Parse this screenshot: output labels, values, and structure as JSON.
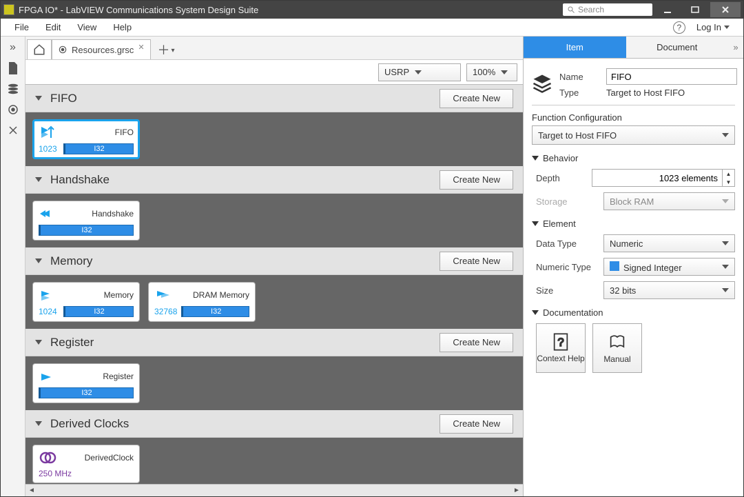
{
  "title": "FPGA IO* - LabVIEW Communications System Design Suite",
  "search_placeholder": "Search",
  "menu": {
    "file": "File",
    "edit": "Edit",
    "view": "View",
    "help": "Help",
    "login": "Log In"
  },
  "tab": {
    "name": "Resources.grsc"
  },
  "toolbar": {
    "target": "USRP",
    "zoom": "100%"
  },
  "sections": [
    {
      "title": "FIFO",
      "create": "Create New",
      "items": [
        {
          "name": "FIFO",
          "n1": "1023",
          "tag": "I32",
          "icon": "fifo",
          "selected": true
        }
      ]
    },
    {
      "title": "Handshake",
      "create": "Create New",
      "items": [
        {
          "name": "Handshake",
          "tag": "I32",
          "icon": "handshake"
        }
      ]
    },
    {
      "title": "Memory",
      "create": "Create New",
      "items": [
        {
          "name": "Memory",
          "n1": "1024",
          "tag": "I32",
          "icon": "memory"
        },
        {
          "name": "DRAM Memory",
          "n1": "32768",
          "tag": "I32",
          "icon": "dram"
        }
      ]
    },
    {
      "title": "Register",
      "create": "Create New",
      "items": [
        {
          "name": "Register",
          "tag": "I32",
          "icon": "register"
        }
      ]
    },
    {
      "title": "Derived Clocks",
      "create": "Create New",
      "items": [
        {
          "name": "DerivedClock",
          "n1": "250 MHz",
          "icon": "clock"
        }
      ]
    }
  ],
  "panel": {
    "tabs": {
      "item": "Item",
      "document": "Document"
    },
    "name_label": "Name",
    "name_value": "FIFO",
    "type_label": "Type",
    "type_value": "Target to Host FIFO",
    "func_cfg_label": "Function Configuration",
    "func_cfg_value": "Target to Host FIFO",
    "behavior": "Behavior",
    "depth_label": "Depth",
    "depth_value": "1023 elements",
    "storage_label": "Storage",
    "storage_value": "Block RAM",
    "element": "Element",
    "datatype_label": "Data Type",
    "datatype_value": "Numeric",
    "numtype_label": "Numeric Type",
    "numtype_value": "Signed Integer",
    "size_label": "Size",
    "size_value": "32 bits",
    "documentation": "Documentation",
    "ctx_help": "Context Help",
    "manual": "Manual"
  }
}
